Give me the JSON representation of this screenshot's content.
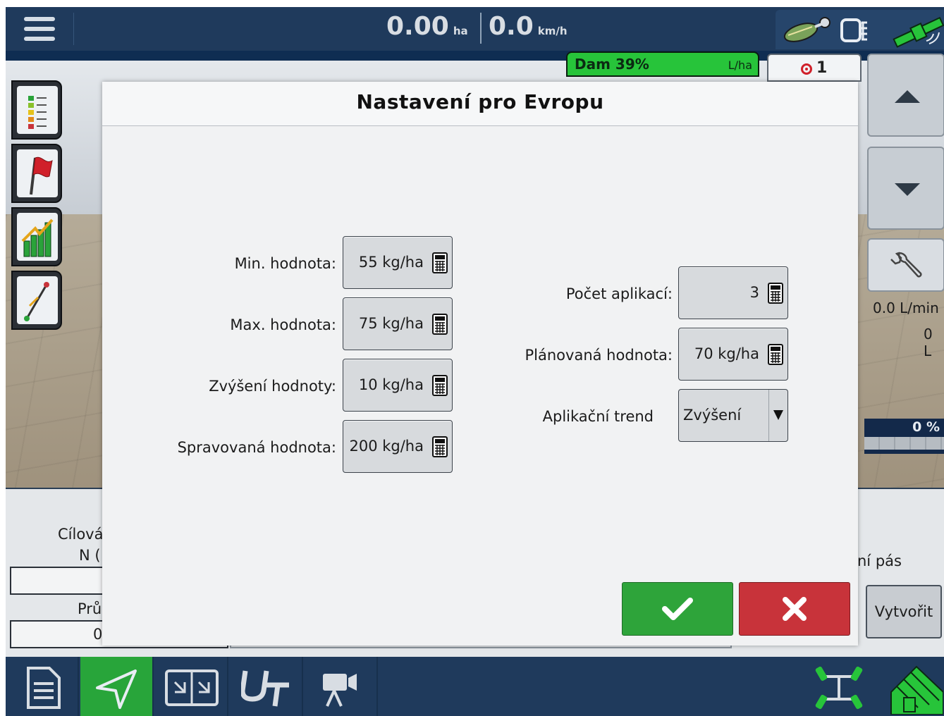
{
  "topbar": {
    "area_value": "0.00",
    "area_unit": "ha",
    "speed_value": "0.0",
    "speed_unit": "km/h",
    "icons": [
      "menu-icon",
      "product-icon",
      "display-icon",
      "gps-satellite-icon"
    ]
  },
  "rate_chip": {
    "label": "Dam 39%",
    "unit": "L/ha"
  },
  "right_panel": {
    "target_count": "1",
    "flow_rate": "0.0 L/min",
    "volume": "0 L",
    "progress": "0 %",
    "buttons": [
      "scroll-up",
      "scroll-down",
      "wrench"
    ]
  },
  "under_panel": {
    "label_target": "Cílová",
    "label_n": "N (",
    "label_avg": "Prů",
    "value_avg": "0",
    "label_swath": "ní pás",
    "create_button": "Vytvořit"
  },
  "dialog": {
    "title": "Nastavení pro Evropu",
    "left_fields": [
      {
        "label": "Min. hodnota:",
        "value": "55 kg/ha"
      },
      {
        "label": "Max. hodnota:",
        "value": "75 kg/ha"
      },
      {
        "label": "Zvýšení hodnoty:",
        "value": "10 kg/ha"
      },
      {
        "label": "Spravovaná hodnota:",
        "value": "200 kg/ha"
      }
    ],
    "right_fields": [
      {
        "label": "Počet aplikací:",
        "value": "3"
      },
      {
        "label": "Plánovaná hodnota:",
        "value": "70 kg/ha"
      }
    ],
    "trend": {
      "label": "Aplikační trend",
      "value": "Zvýšení"
    },
    "ok_icon": "checkmark-icon",
    "cancel_icon": "close-icon"
  },
  "bottom_nav": [
    "document-icon",
    "navigation-icon",
    "split-screen-icon",
    "ut-icon",
    "camera-icon",
    "implement-icon",
    "field-icon"
  ],
  "colors": {
    "nav_blue": "#1f3a5c",
    "accent_green": "#2ea43a",
    "cancel_red": "#c8333a",
    "rate_green": "#27c43a"
  }
}
